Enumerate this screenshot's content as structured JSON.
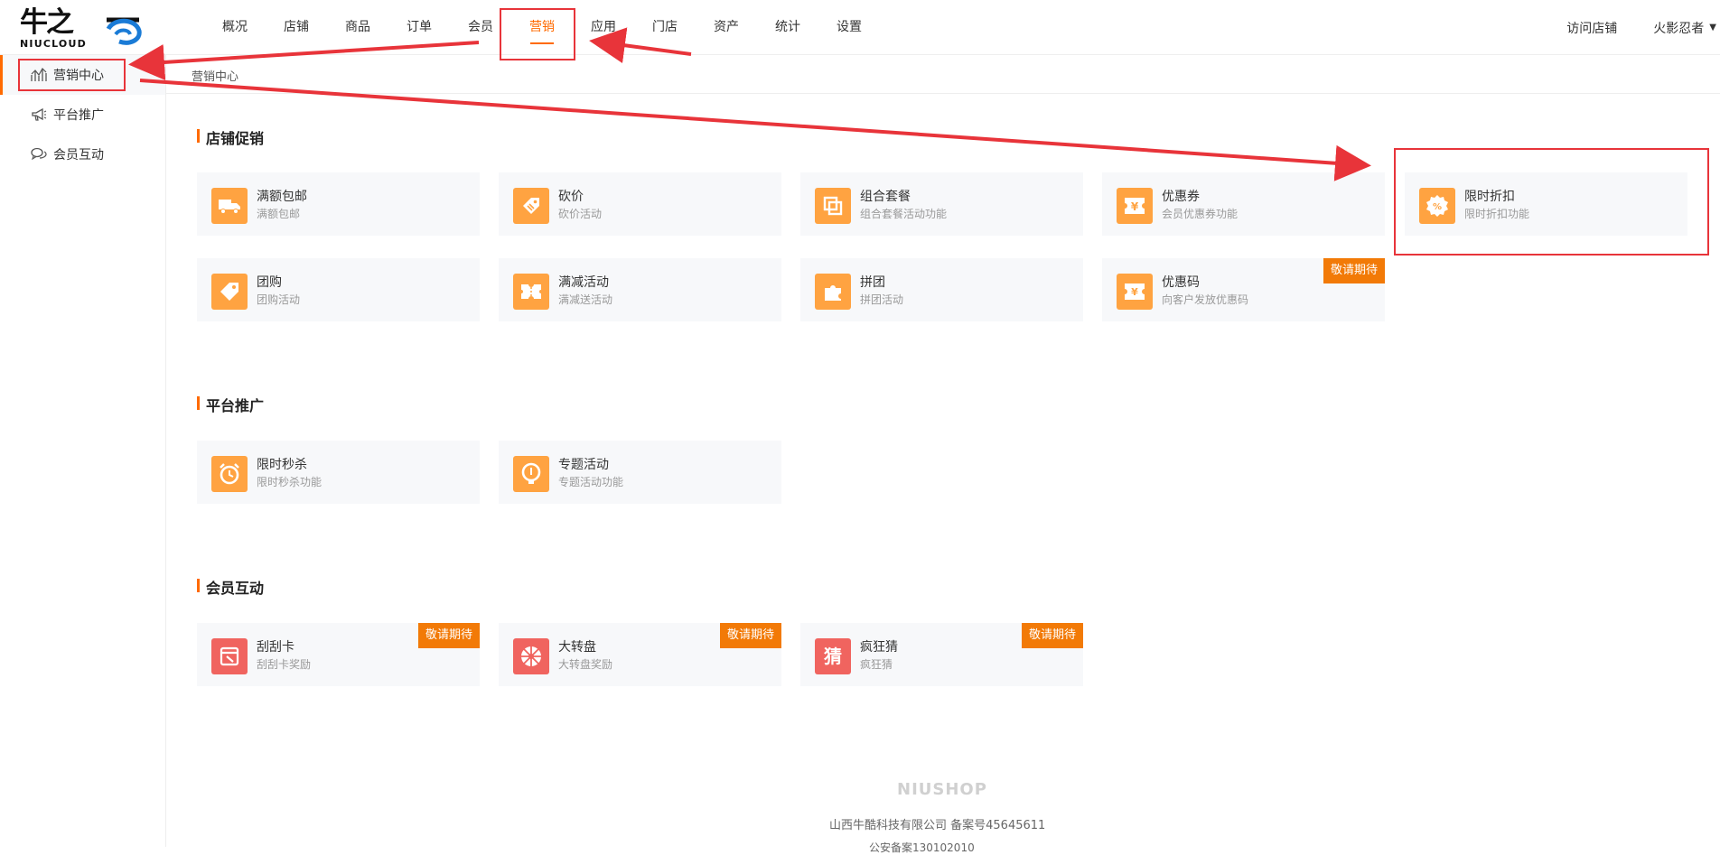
{
  "logo": {
    "cn": "牛之",
    "en": "NIUCLOUD"
  },
  "nav": {
    "items": [
      "概况",
      "店铺",
      "商品",
      "订单",
      "会员",
      "营销",
      "应用",
      "门店",
      "资产",
      "统计",
      "设置"
    ],
    "active": "营销",
    "visit_store": "访问店铺",
    "user": "火影忍者"
  },
  "sidebar": {
    "items": [
      {
        "label": "营销中心",
        "icon": "chart-icon",
        "active": true
      },
      {
        "label": "平台推广",
        "icon": "megaphone-icon"
      },
      {
        "label": "会员互动",
        "icon": "chat-icon"
      }
    ]
  },
  "breadcrumb": "营销中心",
  "sections": {
    "store": {
      "title": "店铺促销",
      "cards": [
        {
          "title": "满额包邮",
          "desc": "满额包邮",
          "icon": "truck-icon"
        },
        {
          "title": "砍价",
          "desc": "砍价活动",
          "icon": "cut-price-icon"
        },
        {
          "title": "组合套餐",
          "desc": "组合套餐活动功能",
          "icon": "combo-icon"
        },
        {
          "title": "优惠券",
          "desc": "会员优惠券功能",
          "icon": "coupon-icon"
        },
        {
          "title": "限时折扣",
          "desc": "限时折扣功能",
          "icon": "discount-icon"
        },
        {
          "title": "团购",
          "desc": "团购活动",
          "icon": "tag-icon"
        },
        {
          "title": "满减活动",
          "desc": "满减送活动",
          "icon": "ticket-icon"
        },
        {
          "title": "拼团",
          "desc": "拼团活动",
          "icon": "puzzle-icon"
        },
        {
          "title": "优惠码",
          "desc": "向客户发放优惠码",
          "icon": "promo-code-icon",
          "badge": "敬请期待"
        }
      ]
    },
    "platform": {
      "title": "平台推广",
      "cards": [
        {
          "title": "限时秒杀",
          "desc": "限时秒杀功能",
          "icon": "alarm-clock-icon"
        },
        {
          "title": "专题活动",
          "desc": "专题活动功能",
          "icon": "bulb-icon"
        }
      ]
    },
    "member": {
      "title": "会员互动",
      "cards": [
        {
          "title": "刮刮卡",
          "desc": "刮刮卡奖励",
          "icon": "scratch-card-icon",
          "badge": "敬请期待"
        },
        {
          "title": "大转盘",
          "desc": "大转盘奖励",
          "icon": "wheel-icon",
          "badge": "敬请期待"
        },
        {
          "title": "疯狂猜",
          "desc": "疯狂猜",
          "icon": "guess-icon",
          "badge": "敬请期待",
          "glyph": "猜"
        }
      ]
    }
  },
  "footer": {
    "brand": "NIUSHOP",
    "company": "山西牛酷科技有限公司  备案号45645611",
    "sub": "公安备案130102010"
  },
  "colors": {
    "accent": "#ff6a00",
    "icon_orange": "#ffa341",
    "icon_red": "#f0645f",
    "badge": "#f27a07",
    "annotation": "#e8343a"
  }
}
